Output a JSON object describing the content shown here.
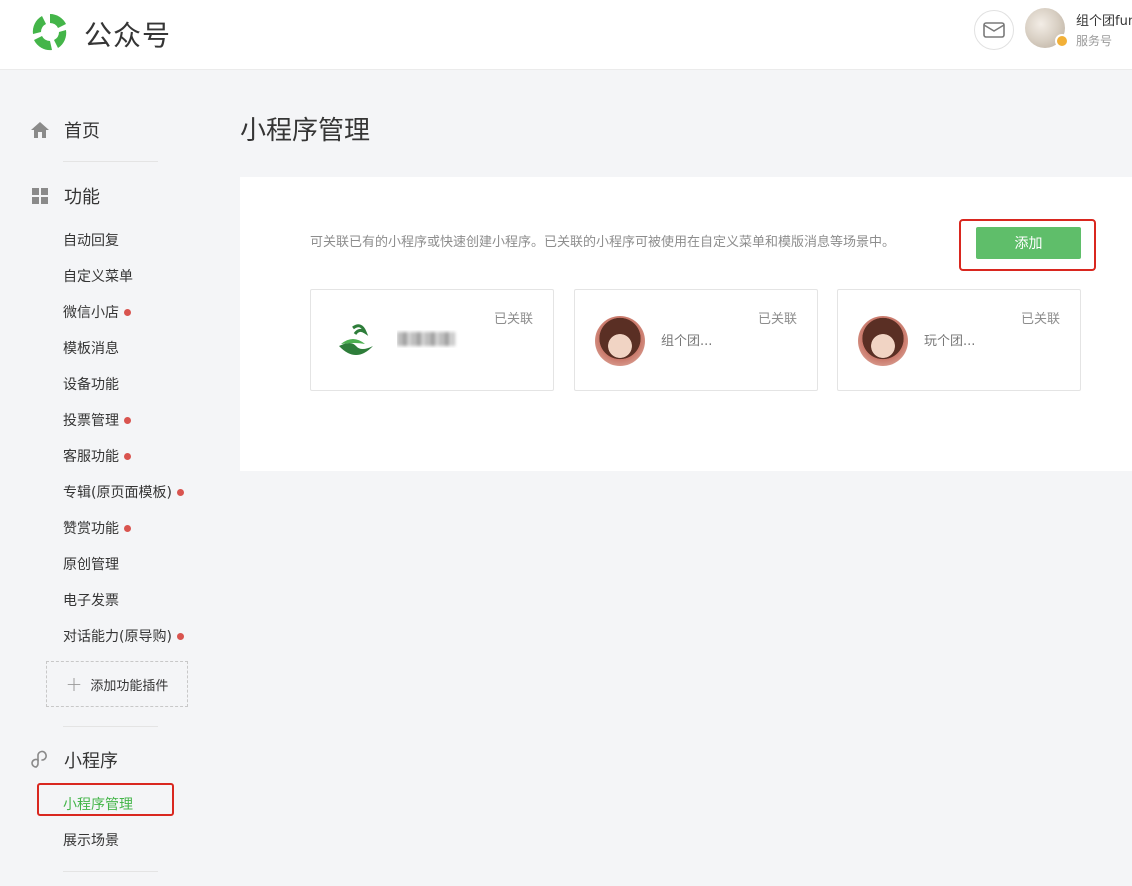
{
  "header": {
    "brand": "公众号",
    "account_name": "组个团fun",
    "account_type": "服务号",
    "icons": [
      "wechat-logo-icon",
      "mail-icon",
      "avatar",
      "verified-icon"
    ]
  },
  "sidebar": {
    "home": {
      "label": "首页",
      "icon": "home-icon"
    },
    "features": {
      "label": "功能",
      "icon": "grid-icon",
      "items": [
        {
          "label": "自动回复",
          "dot": false
        },
        {
          "label": "自定义菜单",
          "dot": false
        },
        {
          "label": "微信小店",
          "dot": true
        },
        {
          "label": "模板消息",
          "dot": false
        },
        {
          "label": "设备功能",
          "dot": false
        },
        {
          "label": "投票管理",
          "dot": true
        },
        {
          "label": "客服功能",
          "dot": true
        },
        {
          "label": "专辑(原页面模板)",
          "dot": true
        },
        {
          "label": "赞赏功能",
          "dot": true
        },
        {
          "label": "原创管理",
          "dot": false
        },
        {
          "label": "电子发票",
          "dot": false
        },
        {
          "label": "对话能力(原导购)",
          "dot": true
        }
      ],
      "add_plugin": "添加功能插件"
    },
    "miniprogram": {
      "label": "小程序",
      "icon": "miniprogram-icon",
      "items": [
        {
          "label": "小程序管理",
          "active": true
        },
        {
          "label": "展示场景",
          "active": false
        }
      ]
    }
  },
  "main": {
    "title": "小程序管理",
    "description": "可关联已有的小程序或快速创建小程序。已关联的小程序可被使用在自定义菜单和模版消息等场景中。",
    "add_button": "添加",
    "cards": [
      {
        "status": "已关联",
        "avatar": "leaf-logo",
        "name_visible": ""
      },
      {
        "status": "已关联",
        "avatar": "anime-girl",
        "name_visible": "组个团..."
      },
      {
        "status": "已关联",
        "avatar": "anime-girl",
        "name_visible": "玩个团..."
      }
    ]
  },
  "colors": {
    "accent_green": "#44b549",
    "button_green": "#5fbe6a",
    "red_dot": "#d9544f",
    "highlight_box": "#d9271f"
  }
}
